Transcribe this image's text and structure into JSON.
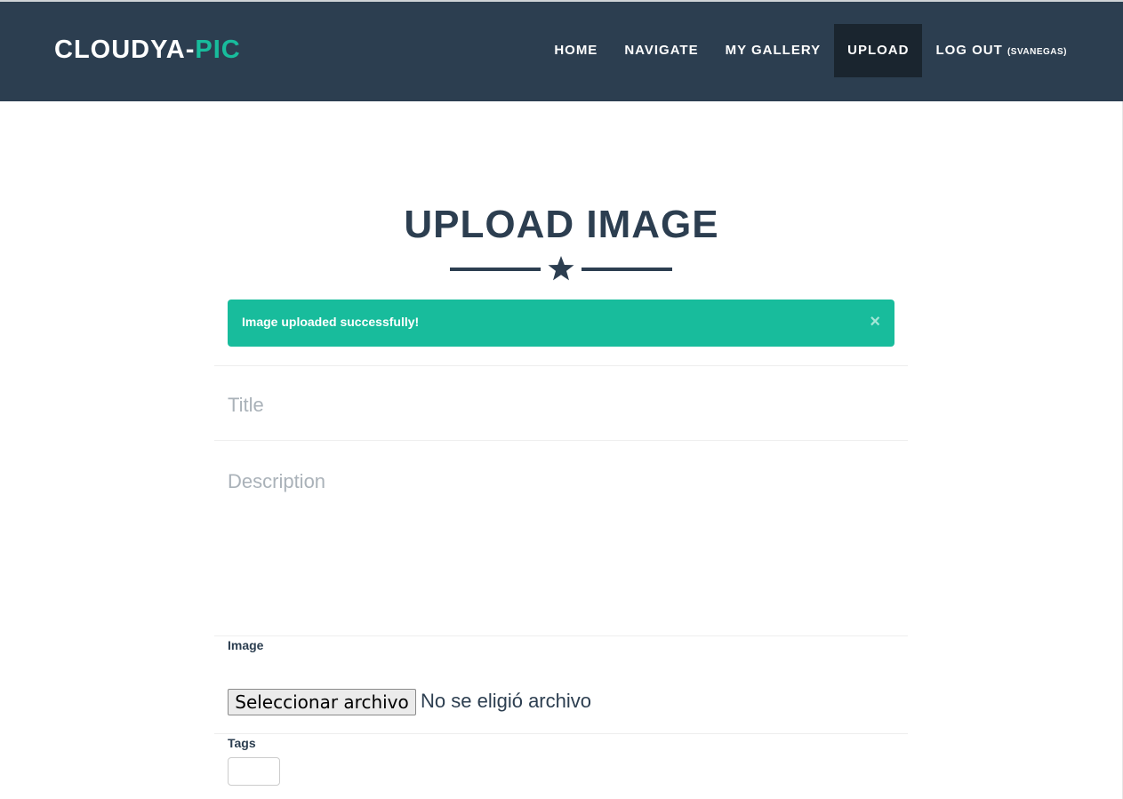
{
  "header": {
    "brand_main": "CLOUDYA-",
    "brand_accent": "PIC",
    "nav": {
      "home": "HOME",
      "navigate": "NAVIGATE",
      "my_gallery": "MY GALLERY",
      "upload": "UPLOAD",
      "logout": "LOG OUT",
      "username": "(SVANEGAS)"
    },
    "active_item": "UPLOAD"
  },
  "page": {
    "title": "UPLOAD IMAGE",
    "divider_icon": "star-icon"
  },
  "alert": {
    "message": "Image uploaded successfully!",
    "close_symbol": "×"
  },
  "form": {
    "title_placeholder": "Title",
    "title_value": "",
    "description_placeholder": "Description",
    "description_value": "",
    "image_label": "Image",
    "file_button": "Seleccionar archivo",
    "file_status": "No se eligió archivo",
    "tags_label": "Tags",
    "tags_value": ""
  },
  "colors": {
    "navbar": "#2c3e50",
    "navbar_active": "#1a252f",
    "accent": "#18bc9c",
    "text": "#2c3e50",
    "placeholder": "#aab2b9"
  }
}
